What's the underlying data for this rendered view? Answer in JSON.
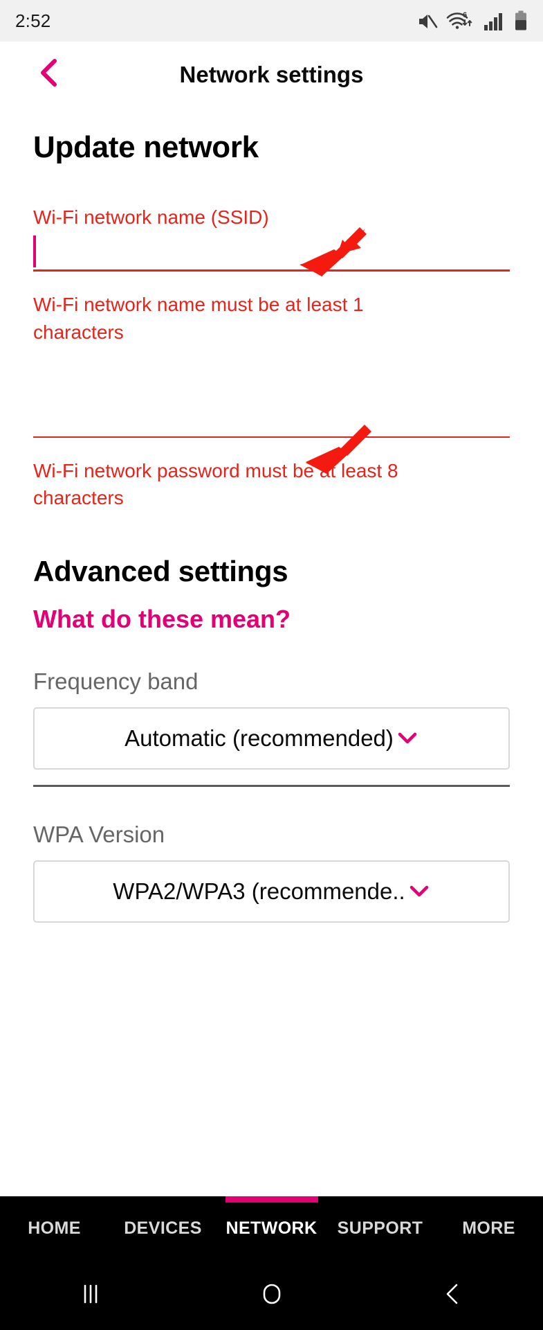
{
  "status_bar": {
    "time": "2:52",
    "icons": [
      "mute-icon",
      "wifi6-icon",
      "signal-icon",
      "battery-icon"
    ]
  },
  "header": {
    "back_icon": "chevron-left-icon",
    "title": "Network settings"
  },
  "update_network": {
    "heading": "Update network",
    "ssid": {
      "label": "Wi-Fi network name (SSID)",
      "value": "",
      "error": "Wi-Fi network name must be at least 1 characters"
    },
    "password": {
      "label": "",
      "value": "",
      "error": "Wi-Fi network password must be at least 8 characters"
    }
  },
  "advanced": {
    "heading": "Advanced settings",
    "help_link": "What do these mean?",
    "frequency_band": {
      "label": "Frequency band",
      "value": "Automatic (recommended)",
      "chevron_icon": "chevron-down-icon"
    },
    "wpa_version": {
      "label": "WPA Version",
      "value": "WPA2/WPA3 (recommende..",
      "chevron_icon": "chevron-down-icon"
    }
  },
  "tab_bar": {
    "tabs": [
      {
        "label": "HOME",
        "active": false
      },
      {
        "label": "DEVICES",
        "active": false
      },
      {
        "label": "NETWORK",
        "active": true
      },
      {
        "label": "SUPPORT",
        "active": false
      },
      {
        "label": "MORE",
        "active": false
      }
    ]
  },
  "nav_bar": {
    "recents_icon": "recents-icon",
    "home_icon": "home-circle-icon",
    "back_icon": "back-chevron-icon"
  },
  "annotations": {
    "arrow_ssid": "red-arrow-pointing-to-ssid-field",
    "arrow_password": "red-arrow-pointing-to-password-field"
  },
  "colors": {
    "accent_pink": "#e20074",
    "error_red": "#e8231a",
    "annotation_red": "#f51a0f",
    "status_bg": "#f1f1f1",
    "label_gray": "#666666"
  }
}
